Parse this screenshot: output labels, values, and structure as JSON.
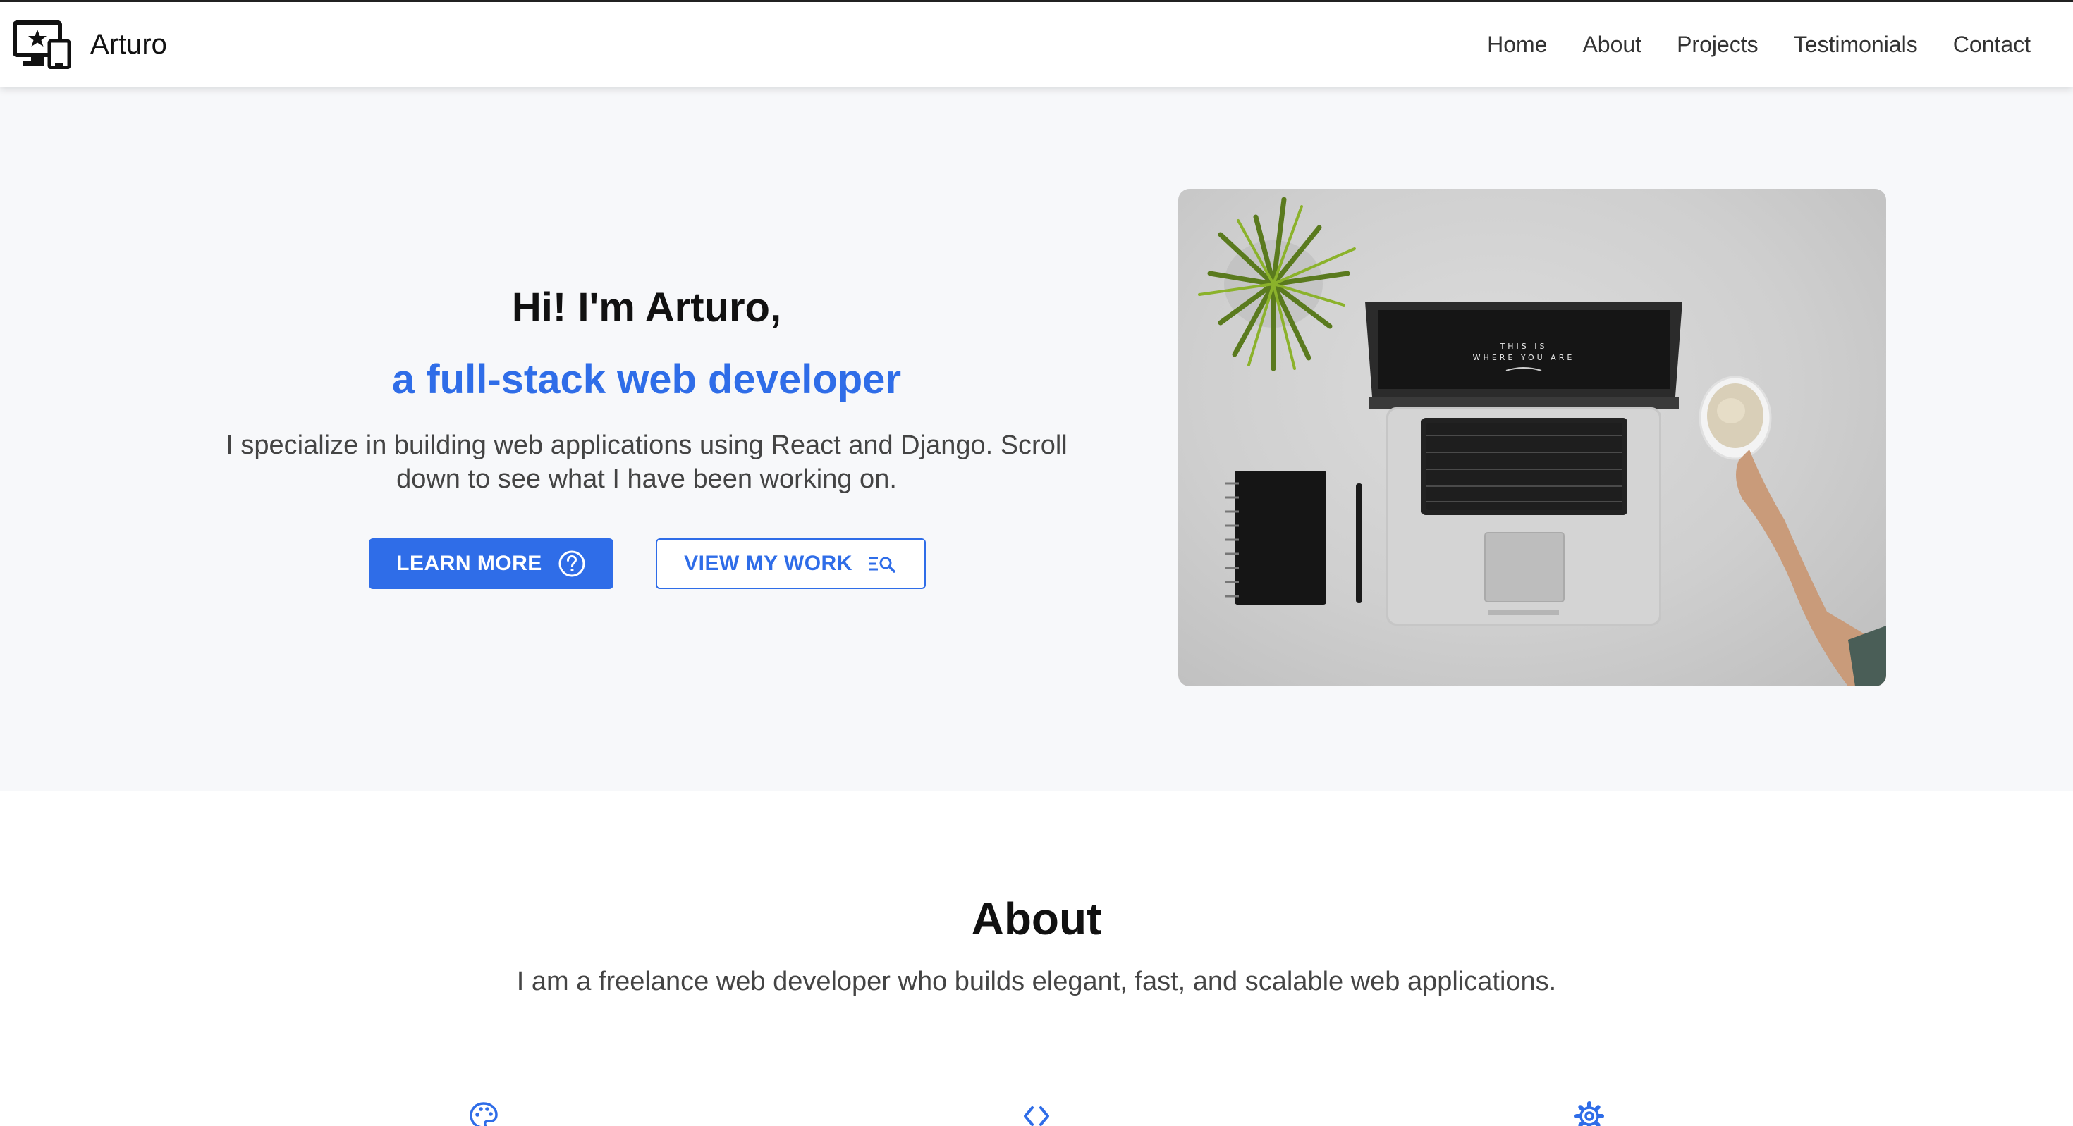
{
  "brand": {
    "name": "Arturo",
    "icon": "devices-icon"
  },
  "nav": {
    "links": [
      "Home",
      "About",
      "Projects",
      "Testimonials",
      "Contact"
    ]
  },
  "hero": {
    "title": "Hi! I'm Arturo,",
    "subtitle": "a full-stack web developer",
    "description": "I specialize in building web applications using React and Django. Scroll down to see what I have been working on.",
    "primary_button": {
      "label": "LEARN MORE",
      "icon": "help-circle-icon"
    },
    "secondary_button": {
      "label": "VIEW MY WORK",
      "icon": "search-list-icon"
    },
    "image": {
      "description_icon": "laptop-desk-photo",
      "screen_text_line1": "THIS IS",
      "screen_text_line2": "WHERE YOU ARE"
    }
  },
  "about": {
    "title": "About",
    "description": "I am a freelance web developer who builds elegant, fast, and scalable web applications.",
    "feature_icons": [
      "palette-icon",
      "code-icon",
      "gear-icon"
    ]
  },
  "colors": {
    "accent": "#2f6de8",
    "hero_bg": "#f7f8fa",
    "text_dark": "#111111",
    "text_muted": "#444444"
  }
}
